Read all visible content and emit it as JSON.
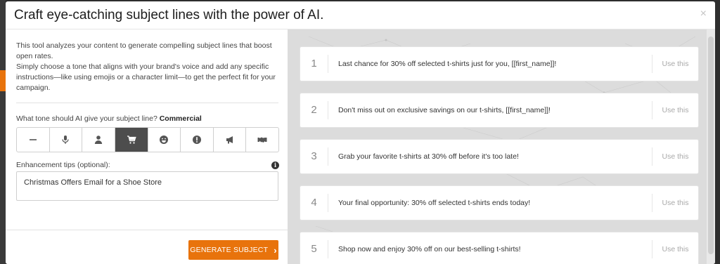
{
  "modal": {
    "title": "Craft eye-catching subject lines with the power of AI.",
    "close_label": "×"
  },
  "left": {
    "description_1": "This tool analyzes your content to generate compelling subject lines that boost open rates.",
    "description_2": "Simply choose a tone that aligns with your brand's voice and add any specific instructions—like using emojis or a character limit—to get the perfect fit for your campaign.",
    "tone_prompt": "What tone should AI give your subject line?",
    "tone_selected": "Commercial",
    "tones": [
      {
        "icon": "dash-icon"
      },
      {
        "icon": "microphone-icon"
      },
      {
        "icon": "person-icon"
      },
      {
        "icon": "shopping-cart-icon",
        "active": true
      },
      {
        "icon": "smiley-icon"
      },
      {
        "icon": "exclamation-icon"
      },
      {
        "icon": "megaphone-icon"
      },
      {
        "icon": "handshake-icon"
      }
    ],
    "tips_label": "Enhancement tips (optional):",
    "tips_value": "Christmas Offers Email for a Shoe Store",
    "generate_label": "GENERATE SUBJECT",
    "generate_chevron": "›"
  },
  "suggestions": [
    {
      "num": "1",
      "text": "Last chance for 30% off selected t-shirts just for you, [[first_name]]!",
      "action": "Use this"
    },
    {
      "num": "2",
      "text": "Don't miss out on exclusive savings on our t-shirts, [[first_name]]!",
      "action": "Use this"
    },
    {
      "num": "3",
      "text": "Grab your favorite t-shirts at 30% off before it's too late!",
      "action": "Use this"
    },
    {
      "num": "4",
      "text": "Your final opportunity: 30% off selected t-shirts ends today!",
      "action": "Use this"
    },
    {
      "num": "5",
      "text": "Shop now and enjoy 30% off on our best-selling t-shirts!",
      "action": "Use this"
    }
  ],
  "colors": {
    "accent": "#e8730c",
    "active_tone": "#4d4d4d"
  }
}
